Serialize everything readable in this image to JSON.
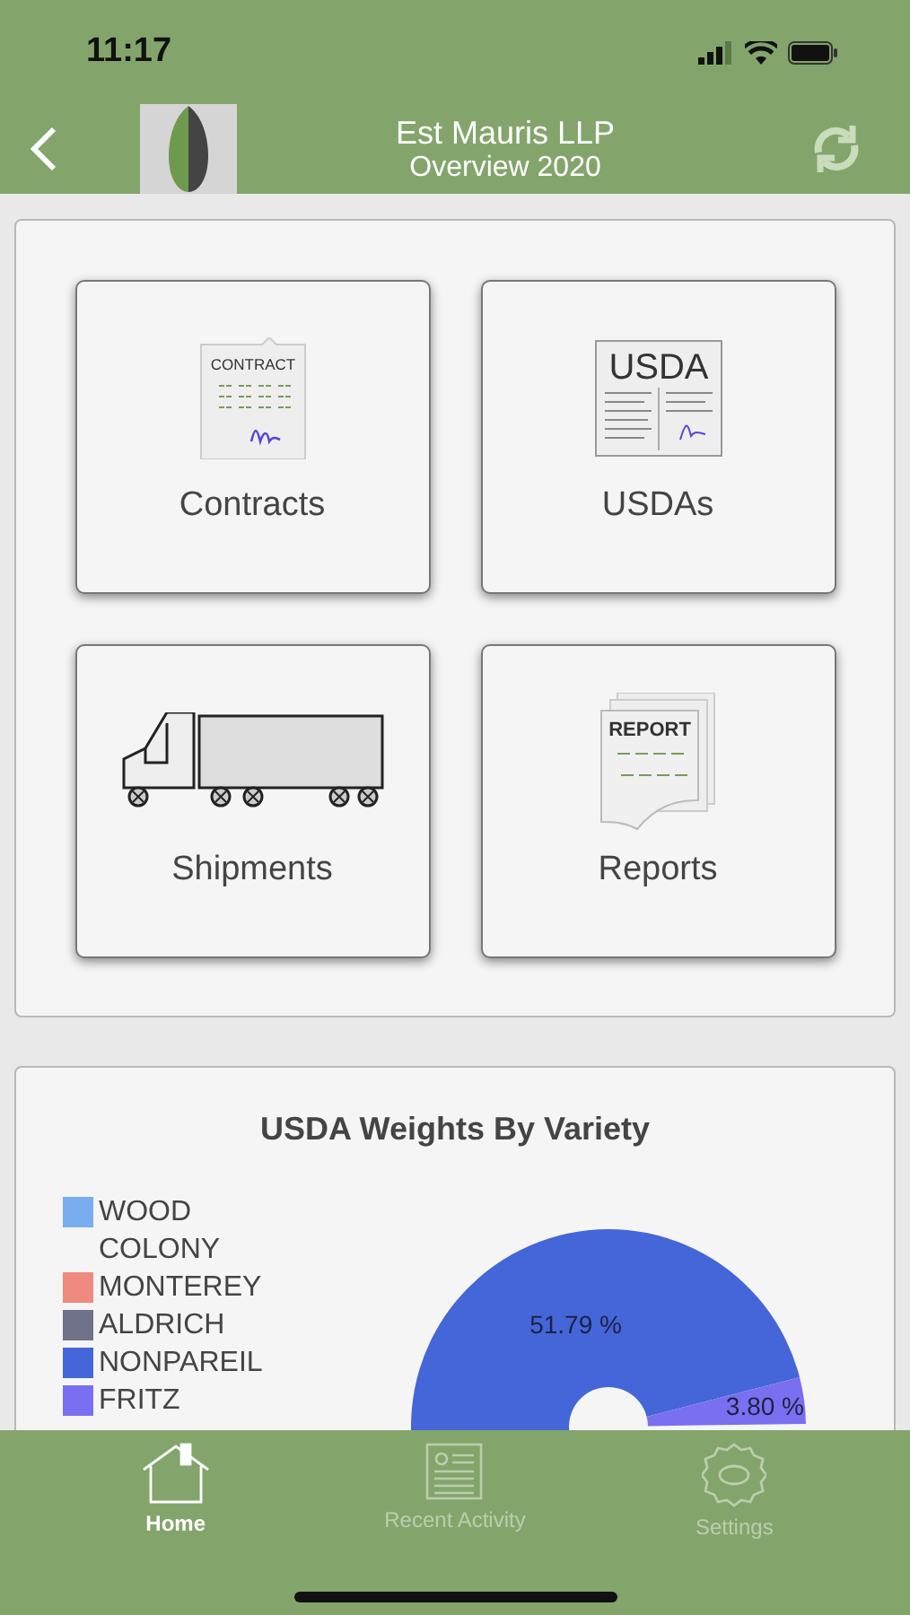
{
  "status_bar": {
    "time": "11:17"
  },
  "nav_bar": {
    "title": "Est Mauris LLP",
    "subtitle": "Overview 2020"
  },
  "tile_rows": [
    {
      "tiles": [
        {
          "label": "Contracts",
          "icon": {
            "kind": "contract",
            "text": "CONTRACT"
          }
        },
        {
          "label": "USDAs",
          "icon": {
            "kind": "usda",
            "text": "USDA"
          }
        }
      ]
    },
    {
      "tiles": [
        {
          "label": "Shipments",
          "icon": {
            "kind": "truck"
          }
        },
        {
          "label": "Reports",
          "icon": {
            "kind": "report",
            "text": "REPORT"
          }
        }
      ]
    }
  ],
  "chart_card": {
    "chart_data": {
      "type": "donut",
      "title": "USDA Weights By Variety",
      "legend": "left",
      "categories": [
        "WOOD COLONY",
        "MONTEREY",
        "ALDRICH",
        "NONPAREIL",
        "FRITZ"
      ],
      "colors": [
        "#78aef0",
        "#ee8a80",
        "#6f7288",
        "#4466d8",
        "#7a6ff0"
      ],
      "values": [
        null,
        null,
        null,
        51.79,
        3.8
      ],
      "value_labels": [
        null,
        null,
        null,
        "51.79 %",
        "3.80 %"
      ]
    }
  },
  "tab_bar": [
    {
      "kind": "home",
      "label": "Home",
      "selected": true
    },
    {
      "kind": "activity",
      "label": "Recent Activity",
      "selected": false
    },
    {
      "kind": "settings",
      "label": "Settings",
      "selected": false
    }
  ]
}
